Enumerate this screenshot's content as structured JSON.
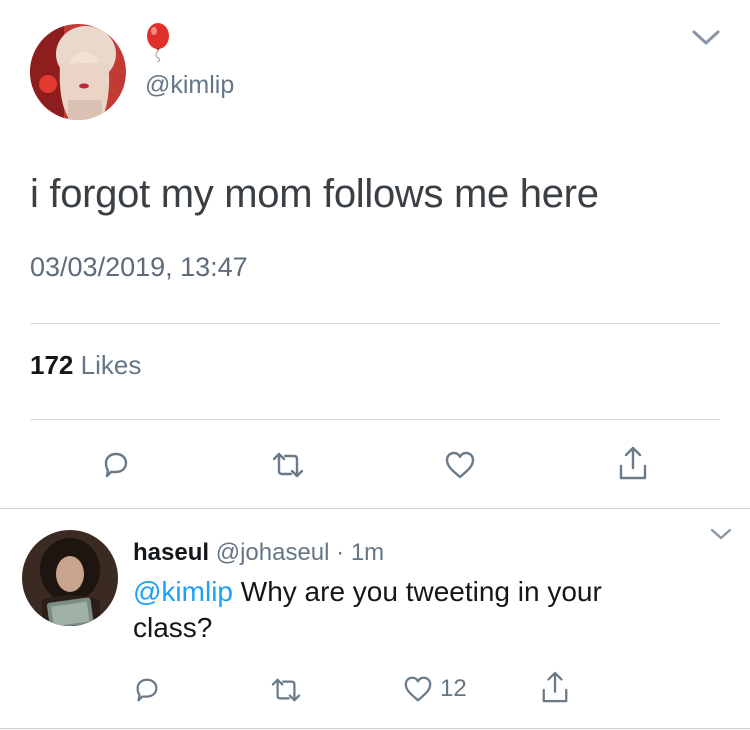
{
  "main_tweet": {
    "display_name": "🎈",
    "handle": "@kimlip",
    "text": "i forgot my mom follows me here",
    "timestamp": "03/03/2019, 13:47",
    "likes_count": "172",
    "likes_label": "Likes"
  },
  "reply": {
    "display_name": "haseul",
    "handle": "@johaseul",
    "separator": "·",
    "time": "1m",
    "mention": "@kimlip",
    "text_line1": " Why are you tweeting in your",
    "text_line2": "class?",
    "like_count": "12"
  },
  "colors": {
    "text": "#14171a",
    "muted": "#657786",
    "link": "#1da1f2",
    "divider": "#d6dbe0",
    "balloon": "#e0302a"
  },
  "icons": {
    "menu": "chevron-down-icon",
    "reply": "reply-icon",
    "retweet": "retweet-icon",
    "like": "heart-icon",
    "share": "share-icon"
  }
}
